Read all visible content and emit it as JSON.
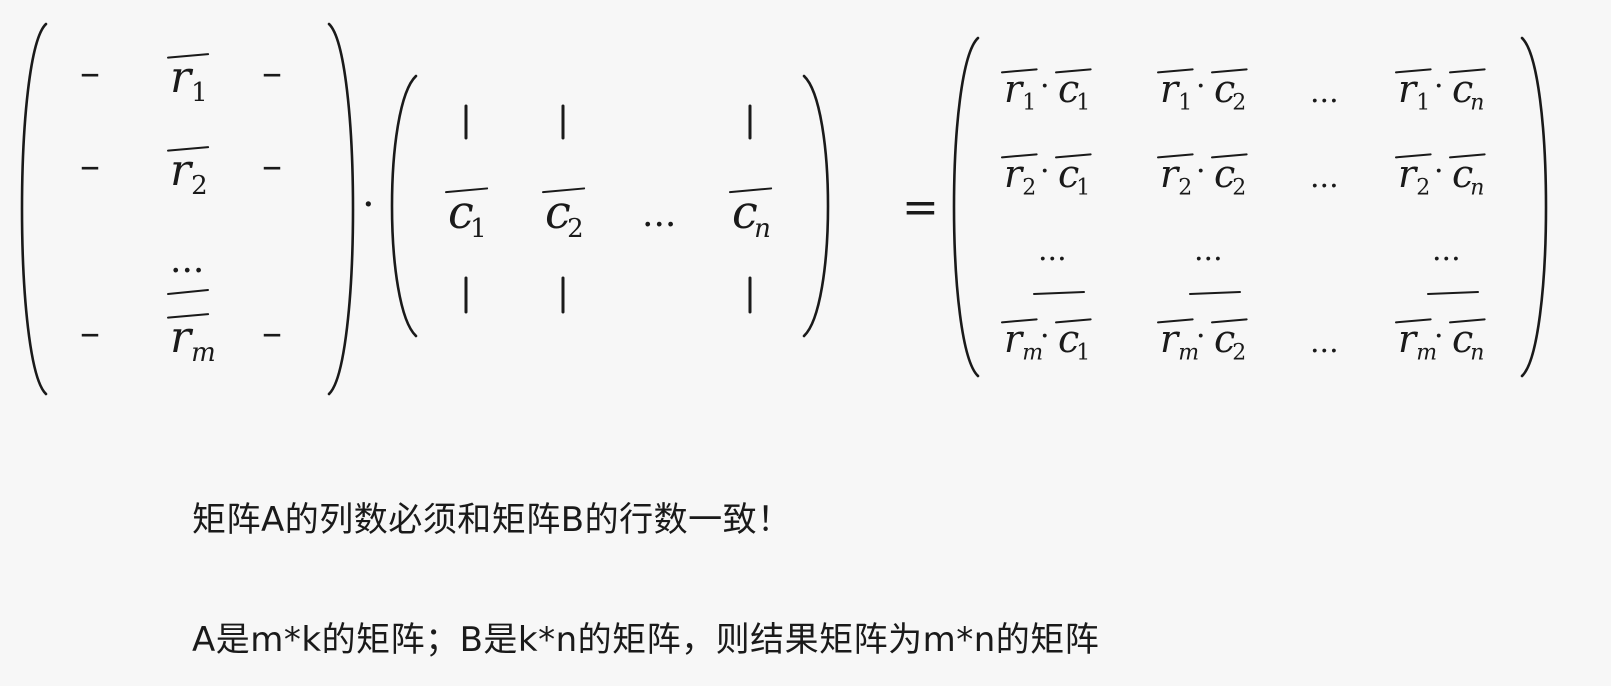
{
  "equation": {
    "matrix_a": {
      "rows": [
        {
          "left": "–",
          "symbol": "r",
          "subscript": "1",
          "right": "–"
        },
        {
          "left": "–",
          "symbol": "r",
          "subscript": "2",
          "right": "–"
        },
        {
          "ellipsis": "..."
        },
        {
          "left": "–",
          "symbol": "r",
          "subscript": "m",
          "right": "–"
        }
      ]
    },
    "dot_operator": "·",
    "matrix_b": {
      "columns": [
        {
          "symbol": "c",
          "subscript": "1"
        },
        {
          "symbol": "c",
          "subscript": "2"
        },
        {
          "ellipsis": "..."
        },
        {
          "symbol": "c",
          "subscript": "n"
        }
      ]
    },
    "equals": "=",
    "matrix_result": {
      "rows": [
        [
          {
            "r": "1",
            "c": "1"
          },
          {
            "r": "1",
            "c": "2"
          },
          {
            "ellipsis": "..."
          },
          {
            "r": "1",
            "c": "n"
          }
        ],
        [
          {
            "r": "2",
            "c": "1"
          },
          {
            "r": "2",
            "c": "2"
          },
          {
            "ellipsis": "..."
          },
          {
            "r": "2",
            "c": "n"
          }
        ],
        [
          {
            "ellipsis": "..."
          },
          {
            "ellipsis": "..."
          },
          {},
          {
            "ellipsis": "..."
          }
        ],
        [
          {
            "r": "m",
            "c": "1"
          },
          {
            "r": "m",
            "c": "2"
          },
          {
            "ellipsis": "..."
          },
          {
            "r": "m",
            "c": "n"
          }
        ]
      ]
    }
  },
  "notes": {
    "line1": "矩阵A的列数必须和矩阵B的行数一致！",
    "line2": "A是m*k的矩阵；B是k*n的矩阵，则结果矩阵为m*n的矩阵"
  }
}
